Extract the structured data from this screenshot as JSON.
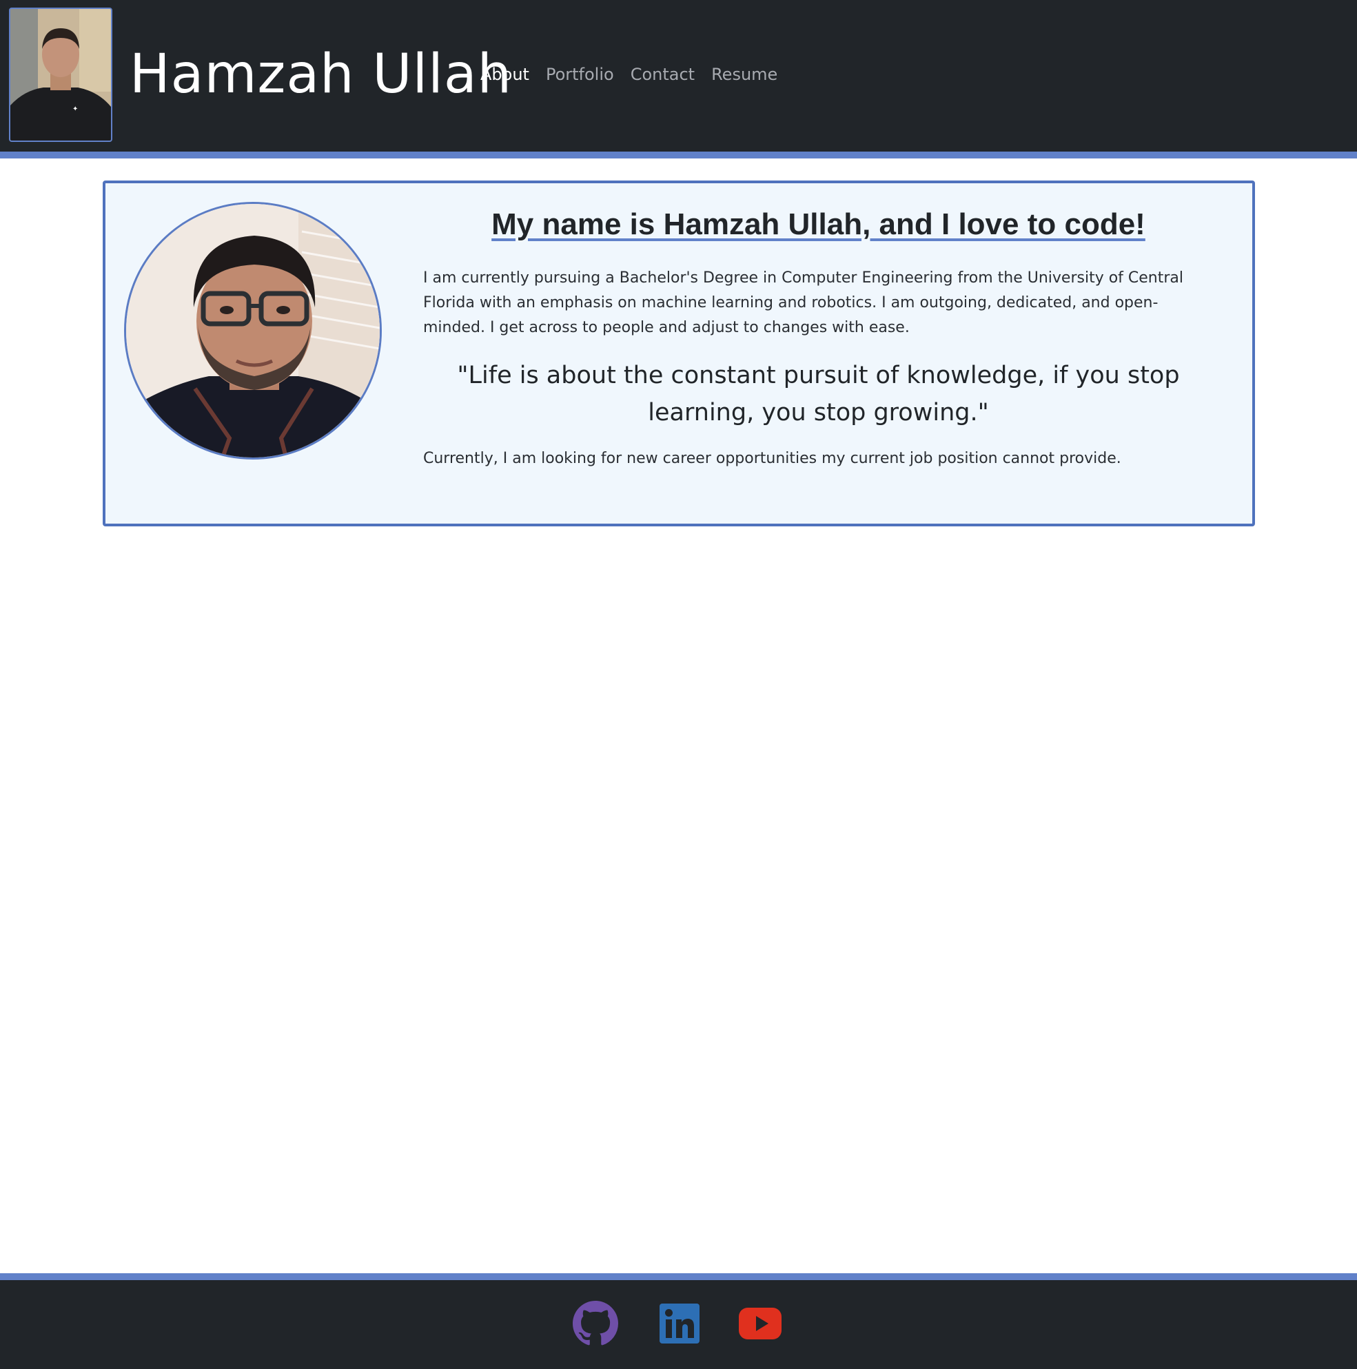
{
  "header": {
    "brand": "Hamzah Ullah",
    "nav": [
      {
        "label": "About",
        "active": true
      },
      {
        "label": "Portfolio",
        "active": false
      },
      {
        "label": "Contact",
        "active": false
      },
      {
        "label": "Resume",
        "active": false
      }
    ]
  },
  "about": {
    "headline": "My name is Hamzah Ullah, and I love to code!",
    "bio": "I am currently pursuing a Bachelor's Degree in Computer Engineering from the University of Central Florida with an emphasis on machine learning and robotics. I am outgoing, dedicated, and open-minded. I get across to people and adjust to changes with ease.",
    "quote": "\"Life is about the constant pursuit of knowledge, if you stop learning, you stop growing.\"",
    "career": "Currently, I am looking for new career opportunities my current job position cannot provide."
  },
  "footer": {
    "links": [
      {
        "icon": "github-icon",
        "color": "#6f4fa8"
      },
      {
        "icon": "linkedin-icon",
        "color": "#2d6fb5"
      },
      {
        "icon": "youtube-icon",
        "color": "#e0301e"
      }
    ]
  },
  "colors": {
    "navbar_bg": "#212529",
    "accent": "#6181c9",
    "card_bg": "#f0f7fd",
    "card_border": "#4f72bd"
  }
}
